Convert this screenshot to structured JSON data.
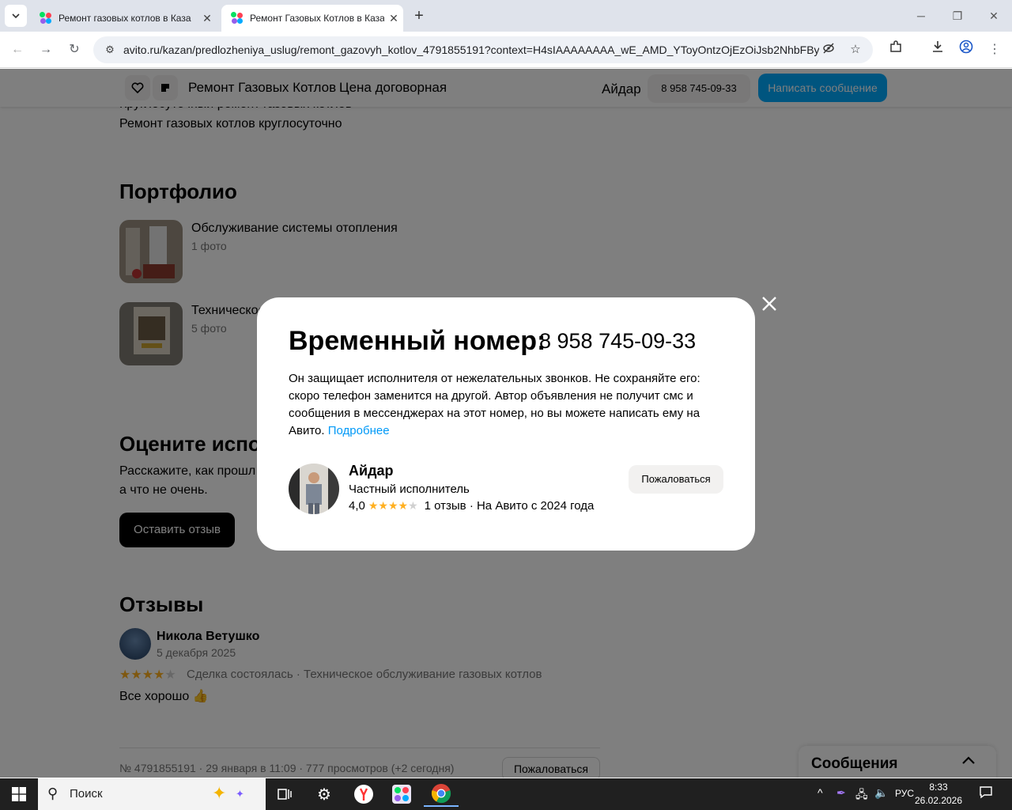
{
  "browser": {
    "tabs": [
      {
        "title": "Ремонт газовых котлов в Каза",
        "active": false
      },
      {
        "title": "Ремонт Газовых Котлов в Каза",
        "active": true
      }
    ],
    "url": "avito.ru/kazan/predlozheniya_uslug/remont_gazovyh_kotlov_4791855191?context=H4sIAAAAAAAA_wE_AMD_YToyOntzOjEzOiJsb2NhbFByaW...",
    "icons": [
      "back-icon",
      "forward-icon",
      "reload-icon",
      "site-settings-icon",
      "eye-off-icon",
      "star-icon",
      "extensions-icon",
      "download-icon",
      "profile-icon",
      "menu-icon"
    ]
  },
  "sticky_header": {
    "title": "Ремонт Газовых Котлов",
    "price": "Цена договорная",
    "seller_name": "Айдар",
    "phone": "8 958 745-09-33",
    "message_button": "Написать сообщение"
  },
  "page": {
    "top_line_1": "Круглосуточный ремонт газовых котлов",
    "top_line_2": "Ремонт газовых котлов круглосуточно",
    "portfolio": {
      "heading": "Портфолио",
      "items": [
        {
          "title": "Обслуживание системы отопления",
          "count": "1 фото"
        },
        {
          "title": "Техническое",
          "count": "5 фото"
        }
      ]
    },
    "rate": {
      "heading": "Оцените испо",
      "text_1": "Расскажите, как прошл",
      "text_2": "а что не очень.",
      "button": "Оставить отзыв"
    },
    "reviews": {
      "heading": "Отзывы",
      "author": "Никола Ветушко",
      "date": "5 декабря 2025",
      "rating": 4,
      "meta": "Сделка состоялась · Техническое обслуживание газовых котлов",
      "text": "Все хорошо 👍"
    },
    "footer_meta": "№ 4791855191 · 29 января в 11:09 · 777 просмотров (+2 сегодня)",
    "complain_button": "Пожаловаться",
    "messages_panel": "Сообщения"
  },
  "modal": {
    "heading": "Временный номер:",
    "phone": "8 958 745-09-33",
    "description": "Он защищает исполнителя от нежелательных звонков. Не сохраняйте его: скоро телефон заменится на другой. Автор объявления не получит смс и сообщения в мессенджерах на этот номер, но вы можете написать ему на Авито.",
    "more_link": "Подробнее",
    "seller": {
      "name": "Айдар",
      "role": "Частный исполнитель",
      "rating_value": "4,0",
      "rating": 4,
      "reviews": "1 отзыв · На Авито с 2024 года"
    },
    "complain_button": "Пожаловаться"
  },
  "taskbar": {
    "search_placeholder": "Поиск",
    "language": "РУС",
    "time": "8:33",
    "date": "26.02.2026"
  },
  "colors": {
    "accent_blue": "#00aaff",
    "link_blue": "#0099f7",
    "star": "#ffb021"
  }
}
